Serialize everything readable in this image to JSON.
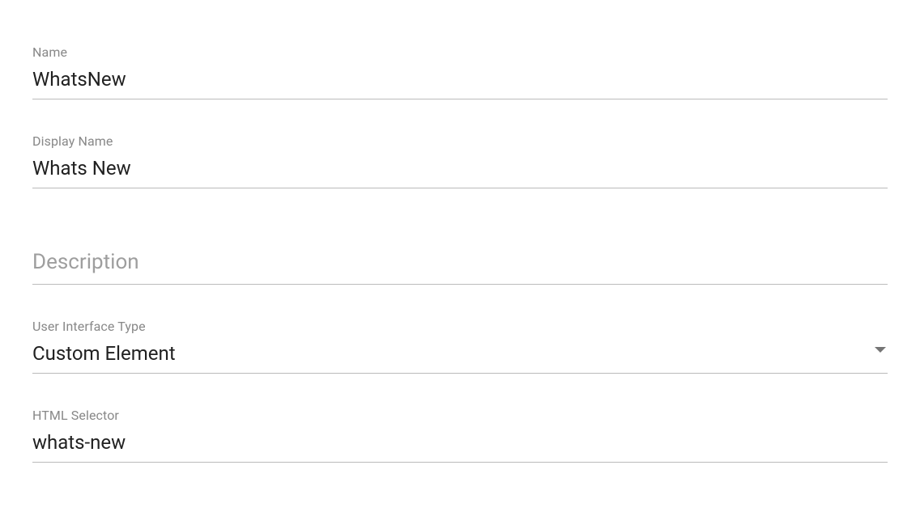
{
  "fields": {
    "name": {
      "label": "Name",
      "value": "WhatsNew"
    },
    "displayName": {
      "label": "Display Name",
      "value": "Whats New"
    },
    "description": {
      "placeholder": "Description",
      "value": ""
    },
    "uiType": {
      "label": "User Interface Type",
      "value": "Custom Element"
    },
    "htmlSelector": {
      "label": "HTML Selector",
      "value": "whats-new"
    }
  }
}
